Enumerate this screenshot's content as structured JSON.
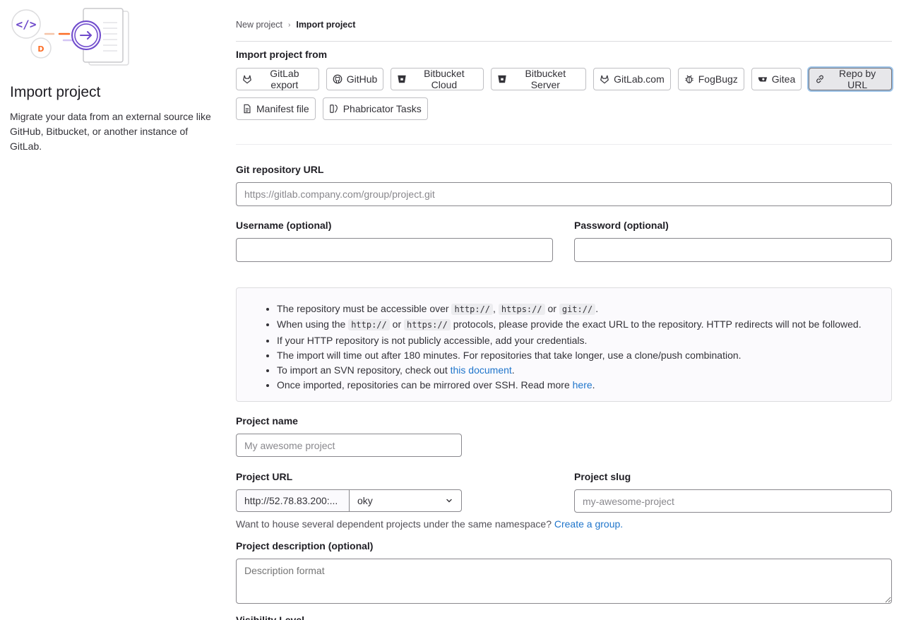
{
  "left": {
    "title": "Import project",
    "description": "Migrate your data from an external source like GitHub, Bitbucket, or another instance of GitLab."
  },
  "breadcrumb": {
    "parent": "New project",
    "current": "Import project"
  },
  "import_from_label": "Import project from",
  "sources": [
    {
      "label": "GitLab export",
      "icon": "tanuki-icon"
    },
    {
      "label": "GitHub",
      "icon": "github-icon"
    },
    {
      "label": "Bitbucket Cloud",
      "icon": "bitbucket-icon"
    },
    {
      "label": "Bitbucket Server",
      "icon": "bitbucket-icon"
    },
    {
      "label": "GitLab.com",
      "icon": "tanuki-icon"
    },
    {
      "label": "FogBugz",
      "icon": "bug-icon"
    },
    {
      "label": "Gitea",
      "icon": "gitea-icon"
    },
    {
      "label": "Repo by URL",
      "icon": "link-icon",
      "active": true
    },
    {
      "label": "Manifest file",
      "icon": "document-icon"
    },
    {
      "label": "Phabricator Tasks",
      "icon": "phabricator-icon"
    }
  ],
  "form": {
    "git_url_label": "Git repository URL",
    "git_url_placeholder": "https://gitlab.company.com/group/project.git",
    "username_label": "Username (optional)",
    "password_label": "Password (optional)",
    "project_name_label": "Project name",
    "project_name_placeholder": "My awesome project",
    "project_url_label": "Project URL",
    "project_url_prefix": "http://52.78.83.200:...",
    "namespace_value": "oky",
    "project_slug_label": "Project slug",
    "project_slug_placeholder": "my-awesome-project",
    "help_text": "Want to house several dependent projects under the same namespace?",
    "help_link": "Create a group.",
    "description_label": "Project description (optional)",
    "description_placeholder": "Description format",
    "visibility_label": "Visibility Level"
  },
  "info": {
    "line1_a": "The repository must be accessible over",
    "line1_code1": "http://",
    "line1_sep": ",",
    "line1_code2": "https://",
    "line1_or": "or",
    "line1_code3": "git://",
    "line1_end": ".",
    "line2_a": "When using the",
    "line2_code1": "http://",
    "line2_or": "or",
    "line2_code2": "https://",
    "line2_b": "protocols, please provide the exact URL to the repository. HTTP redirects will not be followed.",
    "line3": "If your HTTP repository is not publicly accessible, add your credentials.",
    "line4": "The import will time out after 180 minutes. For repositories that take longer, use a clone/push combination.",
    "line5_a": "To import an SVN repository, check out",
    "line5_link": "this document",
    "line5_end": ".",
    "line6_a": "Once imported, repositories can be mirrored over SSH. Read more",
    "line6_link": "here",
    "line6_end": "."
  },
  "colors": {
    "accent": "#1f75cb",
    "illustration_purple": "#6e49cb",
    "illustration_orange": "#e24329"
  }
}
